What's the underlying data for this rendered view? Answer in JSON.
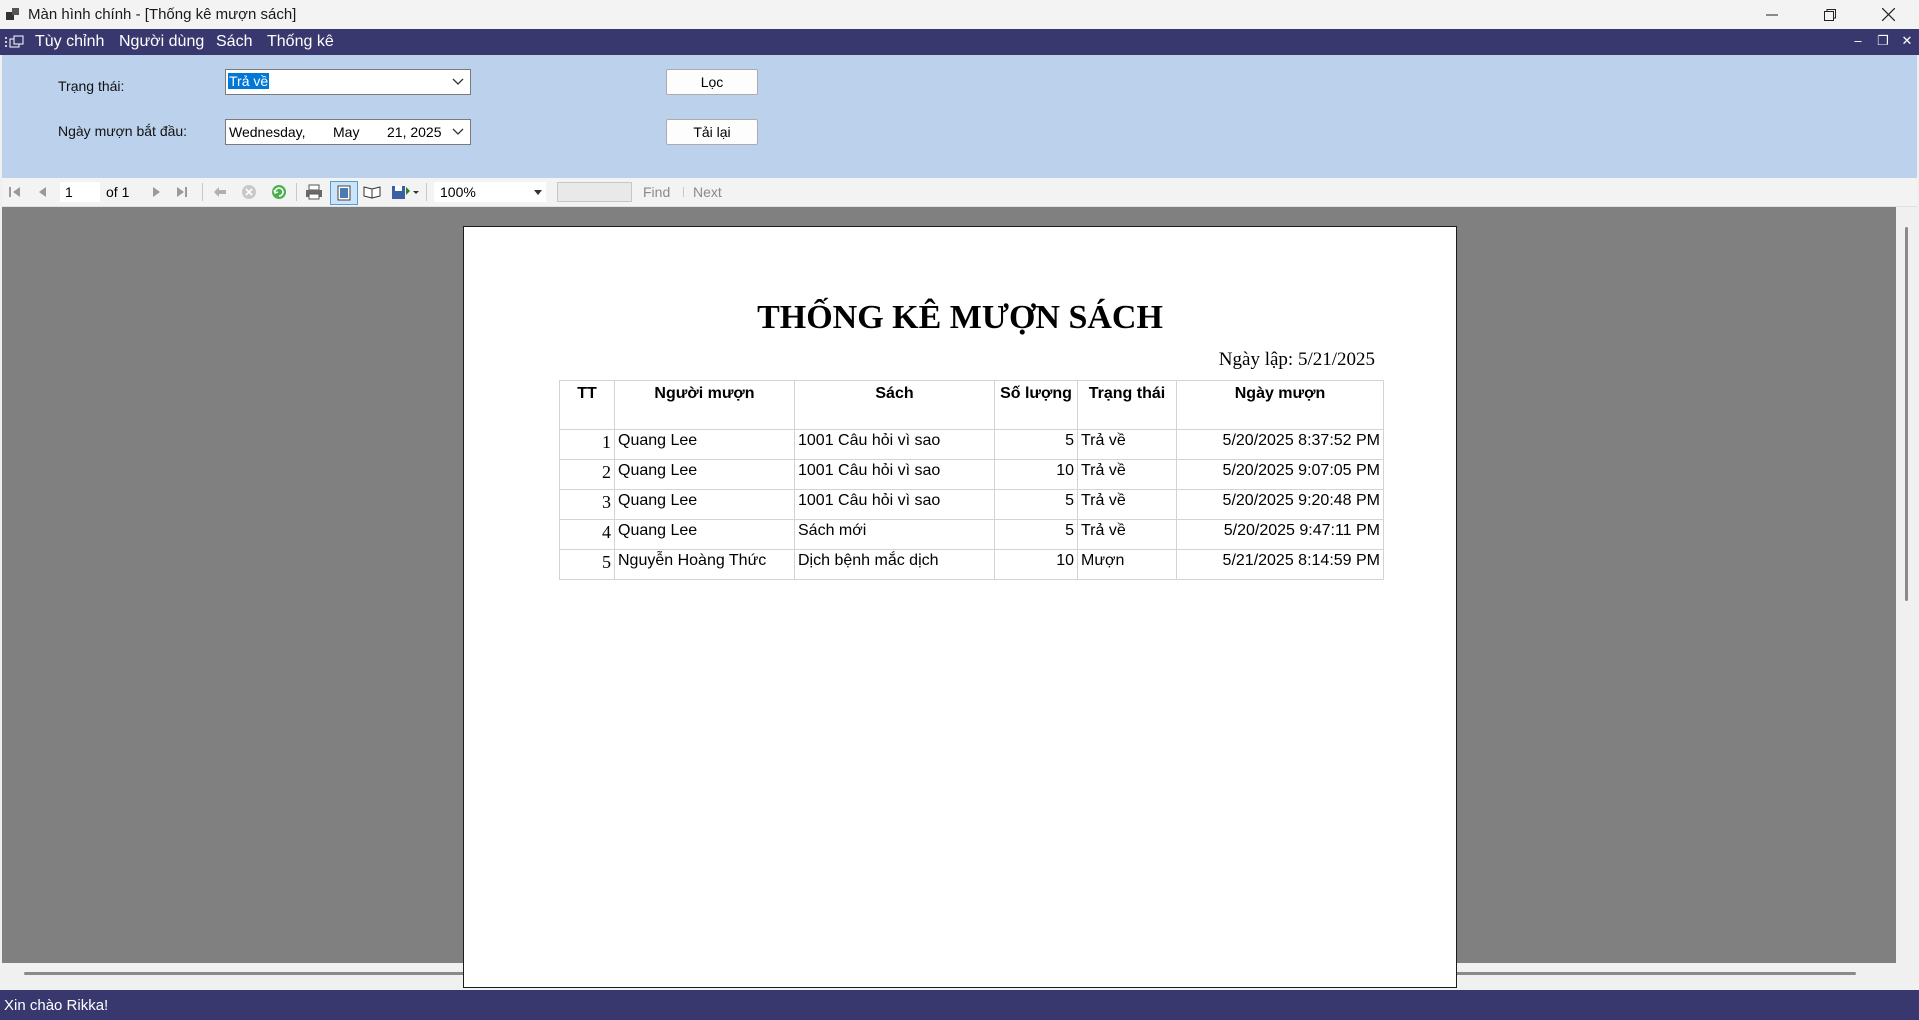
{
  "window": {
    "title": "Màn hình chính - [Thống kê mượn sách]",
    "controls": [
      "minimize-icon",
      "restore-icon",
      "close-icon"
    ]
  },
  "menu": {
    "items": [
      "Tùy chỉnh",
      "Người dùng",
      "Sách",
      "Thống kê"
    ]
  },
  "filter": {
    "status_label": "Trạng thái:",
    "status_value": "Trả về",
    "start_date_label": "Ngày mượn bắt đầu:",
    "date_day": "Wednesday,",
    "date_month": "May",
    "date_rest": "21, 2025",
    "filter_button": "Lọc",
    "reload_button": "Tải lại"
  },
  "toolbar": {
    "page_current": "1",
    "page_of": "of 1",
    "zoom": "100%",
    "find_label": "Find",
    "next_label": "Next"
  },
  "report": {
    "title": "THỐNG KÊ MƯỢN SÁCH",
    "date_line": "Ngày lập: 5/21/2025",
    "columns": [
      "TT",
      "Người mượn",
      "Sách",
      "Số lượng",
      "Trạng thái",
      "Ngày mượn"
    ],
    "rows": [
      [
        "1",
        "Quang Lee",
        "1001 Câu hỏi vì sao",
        "5",
        "Trả về",
        "5/20/2025 8:37:52 PM"
      ],
      [
        "2",
        "Quang Lee",
        "1001 Câu hỏi vì sao",
        "10",
        "Trả về",
        "5/20/2025 9:07:05 PM"
      ],
      [
        "3",
        "Quang Lee",
        "1001 Câu hỏi vì sao",
        "5",
        "Trả về",
        "5/20/2025 9:20:48 PM"
      ],
      [
        "4",
        "Quang Lee",
        "Sách mới",
        "5",
        "Trả về",
        "5/20/2025 9:47:11 PM"
      ],
      [
        "5",
        "Nguyễn Hoàng Thức",
        "Dịch bệnh mắc dịch",
        "10",
        "Mượn",
        "5/21/2025 8:14:59 PM"
      ]
    ]
  },
  "status_bar": {
    "text": "Xin chào Rikka!"
  },
  "colors": {
    "menu_bg": "#38386e",
    "filter_bg": "#bcd1eb",
    "viewer_bg": "#808080",
    "selection": "#0078d7"
  }
}
